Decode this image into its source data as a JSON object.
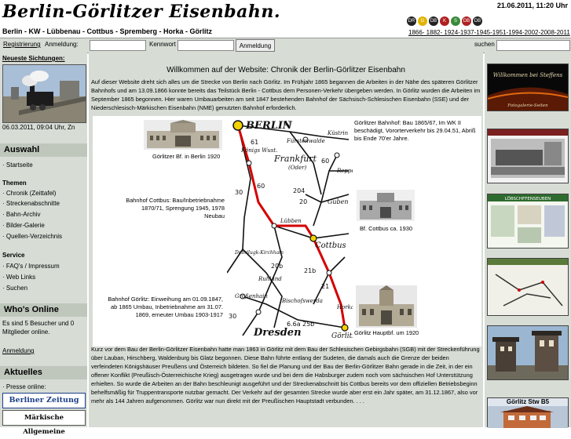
{
  "header": {
    "title": "Berlin-Görlitzer Eisenbahn.",
    "datetime": "21.06.2011, 11:20 Uhr",
    "route": "Berlin - KW - Lübbenau - Cottbus - Spremberg - Horka - Görlitz",
    "years": "1866- 1882- 1924-1937-1945-1951-1994-2002-2008-2011",
    "logos": [
      "DR",
      "G",
      "DB",
      "K",
      "S",
      "DB",
      "DB"
    ]
  },
  "topbar": {
    "register": "Registrierung",
    "login_label": "Anmeldung:",
    "password_label": "Kennwort",
    "login_button": "Anmeldung",
    "search_label": "suchen"
  },
  "left": {
    "sightings_label": "Neueste Sichtungen:",
    "sighting_caption": "06.03.2011, 09:04 Uhr, Zn",
    "auswahl_title": "Auswahl",
    "startseite": "· Startseite",
    "themen_title": "Themen",
    "themen_items": [
      "· Chronik (Zeittafel)",
      "· Streckenabschnitte",
      "· Bahn-Archiv",
      "· Bilder-Galerie",
      "· Quellen-Verzeichnis"
    ],
    "service_title": "Service",
    "service_items": [
      "· FAQ's / Impressum",
      "· Web Links",
      "· Suchen"
    ],
    "online_title": "Who's Online",
    "online_text": "Es sind 5 Besucher und 0 Mitglieder online.",
    "online_login": "Anmeldung",
    "aktuelles_title": "Aktuelles",
    "presse_label": "· Presse online:",
    "paper1": "Berliner Zeitung",
    "paper2": "Märkische Allgemeine"
  },
  "main": {
    "welcome": "Willkommen auf der Website: Chronik der Berlin-Görlitzer Eisenbahn",
    "intro": "Auf dieser Website dreht sich alles um die Strecke von Berlin nach Görlitz. Im Frühjahr 1865 begannen die Arbeiten in der Nähe des späteren Görlitzer Bahnhofs und am 13.09.1866 konnte bereits das Teilstück Berlin - Cottbus dem Personen-Verkehr übergeben werden. In Görlitz wurden die Arbeiten im September 1865 begonnen. Hier waren Umbauarbeiten am seit 1847 bestehenden Bahnhof der Sächsisch-Schlesischen Eisenbahn (SSE) und der Niederschlesisch-Märkischen Eisenbahn (NME) genutzten Bahnhof erforderlich.",
    "cap_goerlitzer_bf": "Görlitzer Bf. in Berlin 1920",
    "cap_goerlitzer_bf_right": "Görlitzer Bahnhof: Bau 1865/67, Im WK II beschädigt, Vororterverkehr bis 29.04.51, Abriß bis Ende 70'er Jahre.",
    "cap_cottbus_left": "Bahnhof Cottbus: Bau/Inbetriebnahme 1870/71, Sprengung 1945, 1978 Neubau",
    "cap_cottbus_photo": "Bf. Cottbus ca. 1930",
    "cap_goerlitz_left": "Bahnhof Görlitz: Einweihung am 01.09.1847, ab 1865 Umbau, Inbetriebnahme am 31.07. 1869, erneuter Umbau 1903-1917",
    "cap_goerlitz_photo": "Görlitz Hauptbf. um 1920",
    "body2": "Kurz vor dem Bau der Berlin-Görlitzer Eisenbahn hatte man 1863 in Görlitz mit dem Bau der Schlesischen Gebirgsbahn (SGB) mit der Streckenführung über Lauban, Hirschberg, Waldenburg bis Glatz begonnen. Diese Bahn führte entlang der Sudeten, die damals auch die Grenze der beiden verfeindeten Königshäuser Preußens und Österreich bildeten. So fiel die Planung und der Bau der Berlin-Görlitzer Bahn gerade in die Zeit, in der ein offener Konflikt (Preußisch-Österreichische Krieg) ausgetragen wurde und bei dem die Habsburger zudem noch vom sächsischen Hof Unterstützung erhielten. So wurde die Arbeiten an der Bahn beschleunigt ausgeführt und der Streckenabschnitt bis Cottbus bereits vor dem offiziellen Betriebsbeginn behelfsmäßig für Truppentransporte nutzbar gemacht. Der Verkehr auf der gesamten Strecke wurde aber erst ein Jahr später, am 31.12.1867, also vor mehr als 144 Jahren aufgenommen. Görlitz war nun direkt mit der Preußischen Hauptstadt verbunden. . . ."
  },
  "map": {
    "cities": [
      "BERLIN",
      "Frankfurt",
      "(Oder)",
      "Cottbus",
      "Guben",
      "Dresden",
      "Görlitz",
      "Lübben",
      "Horka",
      "Großenhain",
      "Bischofswerda",
      "Ruhland",
      "Dobrilugk-Kirchhain",
      "Königs Wust.",
      "Fürstenwalde",
      "Küstrin",
      "Reppen"
    ],
    "numbers": [
      "63",
      "61",
      "60",
      "30",
      "204",
      "20",
      "21b",
      "21",
      "20b",
      "6.6a",
      "25b",
      "60",
      "30"
    ]
  },
  "right": {
    "thumb1_text": "Willkommen bei Steffens",
    "thumb1_sub": "Fotogalerie-Seiten",
    "thumb3_text": "LÖBSCHFFENSEUBEN",
    "thumb4_text": "Görlitz Stw B5"
  },
  "colors": {
    "panel": "#d7dcd5",
    "section": "#bfc7bc",
    "route_red": "#d40000"
  }
}
